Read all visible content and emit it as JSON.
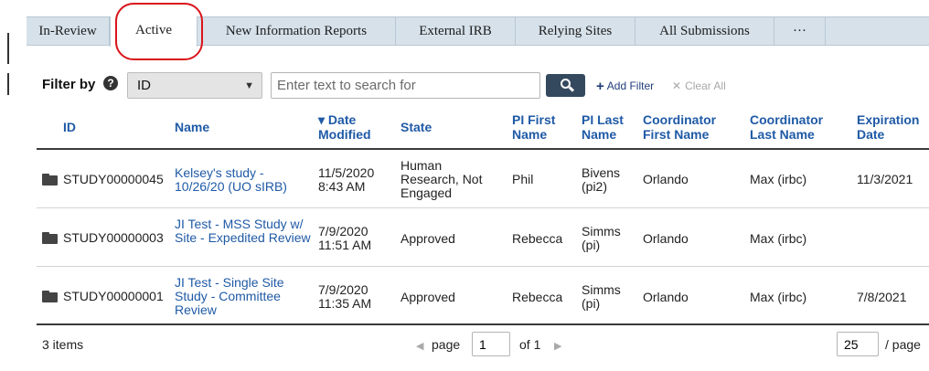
{
  "tabs": [
    {
      "label": "In-Review"
    },
    {
      "label": "Active"
    },
    {
      "label": "New Information Reports"
    },
    {
      "label": "External IRB"
    },
    {
      "label": "Relying Sites"
    },
    {
      "label": "All Submissions"
    },
    {
      "label": "···"
    }
  ],
  "active_tab": "Active",
  "filter": {
    "label": "Filter by",
    "help_icon": "question-circle-icon",
    "field_value": "ID",
    "search_placeholder": "Enter text to search for",
    "search_icon": "search-icon",
    "add_filter_label": "Add Filter",
    "clear_all_label": "Clear All"
  },
  "table": {
    "columns": [
      {
        "label": "ID"
      },
      {
        "label": "Name"
      },
      {
        "label": "Date Modified",
        "sort": "descending",
        "sort_icon": "▾"
      },
      {
        "label": "State"
      },
      {
        "label": "PI First Name"
      },
      {
        "label": "PI Last Name"
      },
      {
        "label": "Coordinator First Name"
      },
      {
        "label": "Coordinator Last Name"
      },
      {
        "label": "Expiration Date"
      }
    ],
    "rows": [
      {
        "icon": "folder-icon",
        "id": "STUDY00000045",
        "name": "Kelsey's study - 10/26/20 (UO sIRB)",
        "date": "11/5/2020 8:43 AM",
        "state": "Human Research, Not Engaged",
        "pi_first": "Phil",
        "pi_last": "Bivens (pi2)",
        "coord_first": "Orlando",
        "coord_last": "Max (irbc)",
        "expiration": "11/3/2021"
      },
      {
        "icon": "folder-icon",
        "id": "STUDY00000003",
        "name": "JI Test - MSS Study w/ Site - Expedited Review",
        "date": "7/9/2020 11:51 AM",
        "state": "Approved",
        "pi_first": "Rebecca",
        "pi_last": "Simms (pi)",
        "coord_first": "Orlando",
        "coord_last": "Max (irbc)",
        "expiration": ""
      },
      {
        "icon": "folder-icon",
        "id": "STUDY00000001",
        "name": "JI Test - Single Site Study - Committee Review",
        "date": "7/9/2020 11:35 AM",
        "state": "Approved",
        "pi_first": "Rebecca",
        "pi_last": "Simms (pi)",
        "coord_first": "Orlando",
        "coord_last": "Max (irbc)",
        "expiration": "7/8/2021"
      }
    ]
  },
  "pager": {
    "items_label": "3 items",
    "page_label": "page",
    "current_page": "1",
    "of_label": "of 1",
    "per_page_value": "25",
    "per_page_label": "/ page"
  },
  "highlight_color": "#d9151b"
}
